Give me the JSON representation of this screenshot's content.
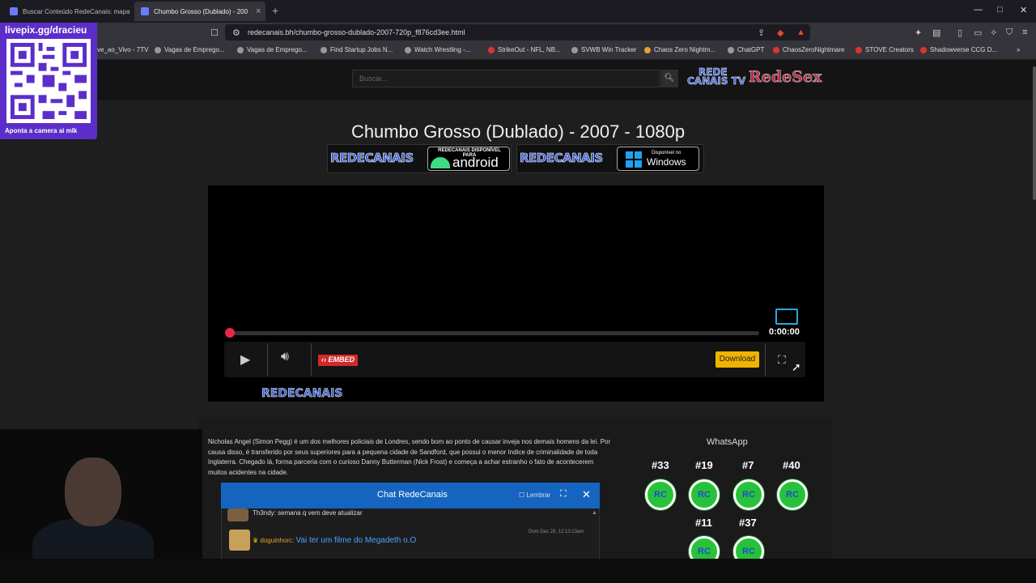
{
  "browser": {
    "tabs": [
      {
        "title": "Buscar Conteúdo RedeCanais: mapa",
        "active": false
      },
      {
        "title": "Chumbo Grosso (Dublado) - 200",
        "active": true
      }
    ],
    "url": "redecanais.bh/chumbo-grosso-dublado-2007-720p_f876cd3ee.html",
    "bookmarks": [
      "ve_ao_Vivo - 7TV",
      "Vagas de Emprego...",
      "Vagas de Emprego...",
      "Find Startup Jobs N...",
      "Watch Wrestling -...",
      "StrikeOut - NFL, NB...",
      "SVWB Win Tracker",
      "Chaos Zero Nightm...",
      "ChatGPT",
      "ChaosZeroNightmare",
      "STOVE Creators",
      "Shadowverse CCG D..."
    ]
  },
  "overlay": {
    "livepix_title": "livepix.gg/dracieu",
    "livepix_caption": "Aponta a camera ai mlk"
  },
  "site": {
    "search_placeholder": "Buscar...",
    "logo_line1": "REDE",
    "logo_line2": "CANAIS TV",
    "logo_brand": "RedeSex",
    "movie_title": "Chumbo Grosso (Dublado) - 2007 - 1080p",
    "banner_brand": "REDECANAIS",
    "android_top": "REDECANAIS DISPONÍVEL PARA",
    "android_label": "android",
    "windows_top": "Disponível no",
    "windows_label": "Windows"
  },
  "player": {
    "time": "0:00:00",
    "embed_label": "EMBED",
    "download_label": "Download",
    "watermark": "REDECANAIS",
    "progress": 0
  },
  "synopsis": "Nicholas Angel (Simon Pegg) é um dos melhores policiais de Londres, sendo bom ao ponto de causar inveja nos demais homens da lei. Por causa disso, é transferido por seus superiores para a pequena cidade de Sandford, que possui o menor índice de criminalidade de toda Inglaterra. Chegado lá, forma parceria com o curioso Danny Butterman (Nick Frost) e começa a achar estranho o fato de acontecerem muitos acidentes na cidade.",
  "chat": {
    "title": "Chat RedeCanais",
    "remember_label": "Lembrar",
    "messages": [
      {
        "user": "Th3ndy",
        "text": "semana q vem deve atualizar"
      },
      {
        "user": "doguinhorc",
        "text": "Vai ter um filme do Megadeth o.O",
        "date": "Dom Dez 28, 12:13:13am"
      }
    ]
  },
  "whatsapp": {
    "title": "WhatsApp",
    "groups": [
      "#33",
      "#19",
      "#7",
      "#40",
      "#11",
      "#37"
    ],
    "icon_label": "RC"
  },
  "colors": {
    "accent_blue": "#1565c0",
    "download_yellow": "#f0b400",
    "progress_red": "#e8274b",
    "whatsapp_green": "#28c23a",
    "livepix_purple": "#5c2ec9"
  }
}
